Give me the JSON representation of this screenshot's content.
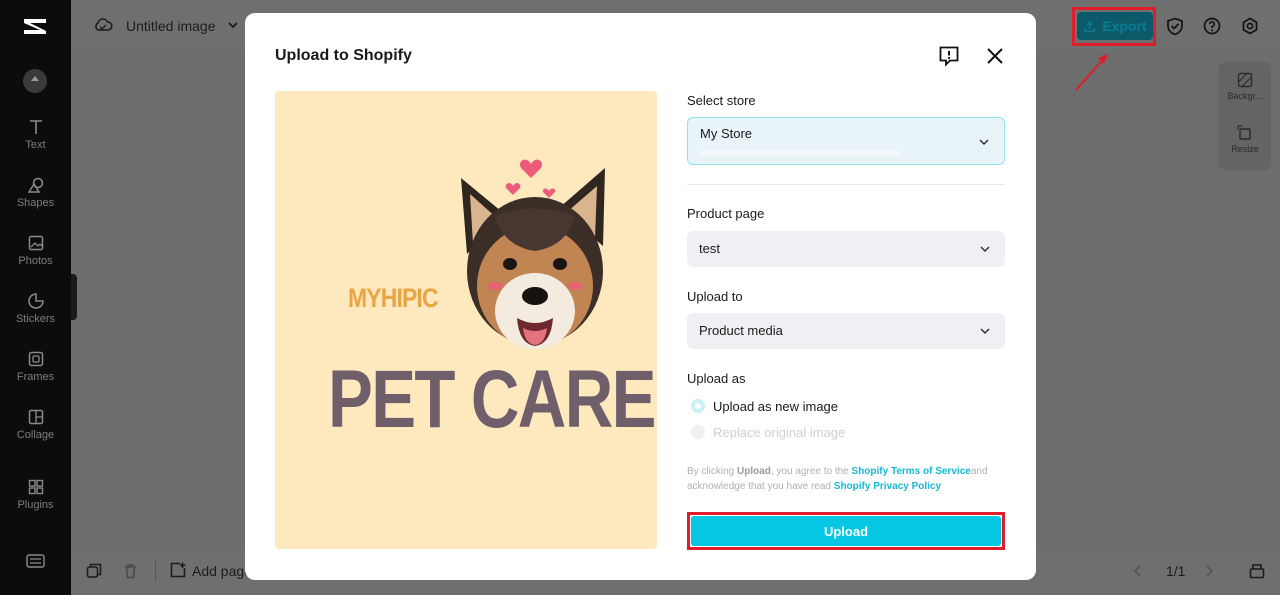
{
  "app": {
    "title": "Untitled image",
    "export_label": "Export"
  },
  "sidebar": {
    "items": [
      {
        "label": "Text",
        "icon": "text-icon"
      },
      {
        "label": "Shapes",
        "icon": "shapes-icon"
      },
      {
        "label": "Photos",
        "icon": "photos-icon"
      },
      {
        "label": "Stickers",
        "icon": "stickers-icon"
      },
      {
        "label": "Frames",
        "icon": "frames-icon"
      },
      {
        "label": "Collage",
        "icon": "collage-icon"
      },
      {
        "label": "Plugins",
        "icon": "plugins-icon"
      }
    ]
  },
  "right_panel": {
    "background_label": "Backgr...",
    "resize_label": "Resize"
  },
  "bottom": {
    "add_page_label": "Add page",
    "page_counter": "1/1"
  },
  "modal": {
    "title": "Upload to Shopify",
    "select_store": {
      "label": "Select store",
      "value": "My Store"
    },
    "product_page": {
      "label": "Product page",
      "value": "test"
    },
    "upload_to": {
      "label": "Upload to",
      "value": "Product media"
    },
    "upload_as": {
      "label": "Upload as",
      "options": [
        {
          "label": "Upload as new image",
          "checked": true,
          "disabled": false
        },
        {
          "label": "Replace original image",
          "checked": false,
          "disabled": true
        }
      ]
    },
    "terms": {
      "prefix": "By clicking ",
      "bold": "Upload",
      "middle": ", you agree to the ",
      "link1": "Shopify Terms of Service",
      "middle2": "and acknowledge that you have read ",
      "link2": "Shopify Privacy Policy"
    },
    "upload_button": "Upload",
    "preview": {
      "brand": "MYHIPIC",
      "headline": "PET CARE"
    }
  },
  "colors": {
    "accent": "#05c7e3",
    "highlight": "#e01e2b",
    "preview_bg": "#fee9bf"
  }
}
